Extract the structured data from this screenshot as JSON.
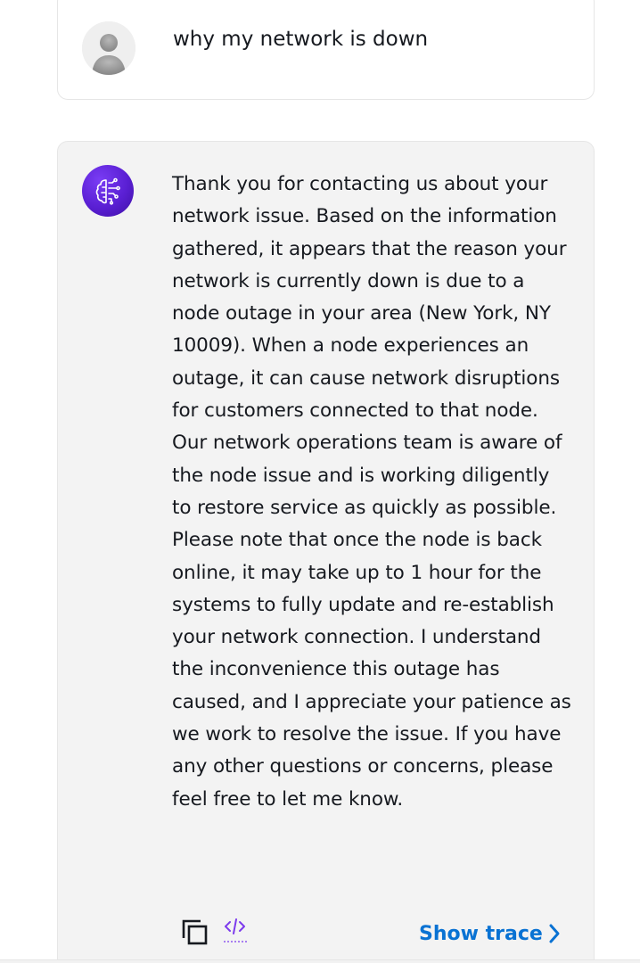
{
  "user_message": {
    "avatar_icon": "user-silhouette-icon",
    "text": "why my network is down"
  },
  "assistant_message": {
    "avatar_icon": "ai-brain-circuit-icon",
    "avatar_color": "#5a1fd3",
    "text": "Thank you for contacting us about your network issue. Based on the information gathered, it appears that the reason your network is currently down is due to a node outage in your area (New York, NY 10009). When a node experiences an outage, it can cause network disruptions for customers connected to that node. Our network operations team is aware of the node issue and is working diligently to restore service as quickly as possible. Please note that once the node is back online, it may take up to 1 hour for the systems to fully update and re-establish your network connection. I understand the inconvenience this outage has caused, and I appreciate your patience as we work to resolve the issue. If you have any other questions or concerns, please feel free to let me know.",
    "actions": {
      "copy_icon": "copy-icon",
      "code_icon": "code-icon",
      "show_trace_label": "Show trace",
      "show_trace_icon": "chevron-right-icon",
      "link_color": "#0972d3"
    }
  }
}
